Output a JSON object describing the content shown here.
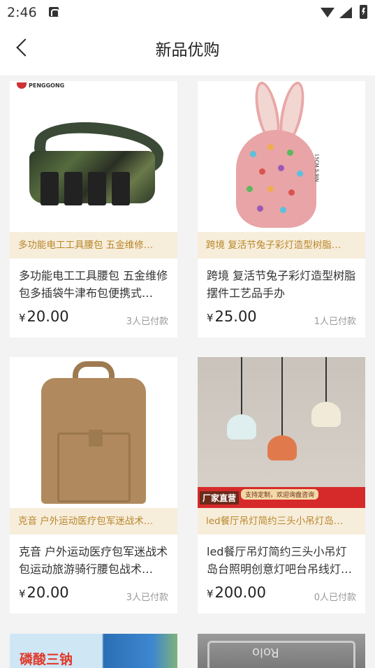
{
  "status_bar": {
    "time": "2:46",
    "icons": [
      "notification-a-icon",
      "wifi-icon",
      "signal-icon",
      "battery-icon"
    ]
  },
  "header": {
    "title": "新品优购",
    "back_icon": "chevron-left-icon"
  },
  "colors": {
    "strip_bg": "#f7eddb",
    "strip_text": "#b8872b",
    "price": "#222222",
    "paid": "#999999",
    "page_bg": "#f3f3f3"
  },
  "products": [
    {
      "strip": "多功能电工工具腰包 五金维修…",
      "name": "多功能电工工具腰包 五金维修包多插袋牛津布包便携式…",
      "currency": "¥",
      "price": "20.00",
      "paid": "3人已付款",
      "image_logo": "PENGGONG"
    },
    {
      "strip": "跨境 复活节兔子彩灯造型树脂…",
      "name": "跨境 复活节兔子彩灯造型树脂摆件工艺品手办",
      "currency": "¥",
      "price": "25.00",
      "paid": "1人已付款",
      "image_note": "15CM 5.9IN"
    },
    {
      "strip": "克音 户外运动医疗包军迷战术…",
      "name": "克音 户外运动医疗包军迷战术包运动旅游骑行腰包战术…",
      "currency": "¥",
      "price": "20.00",
      "paid": "3人已付款"
    },
    {
      "strip": "led餐厅吊灯简约三头小吊灯岛…",
      "name": "led餐厅吊灯简约三头小吊灯岛台照明创意灯吧台吊线灯…",
      "currency": "¥",
      "price": "200.00",
      "paid": "0人已付款",
      "image_label": "厂家直营",
      "image_note": "支持定制，欢迎询盘咨询"
    }
  ],
  "partial_products": [
    {
      "image_text": "磷酸三钠"
    },
    {
      "image_text": "Rolo"
    }
  ]
}
